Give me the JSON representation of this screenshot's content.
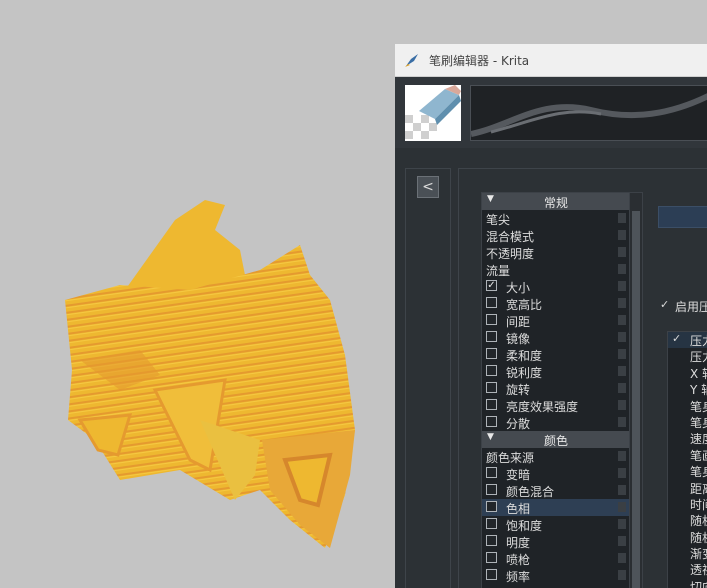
{
  "window": {
    "title": "笔刷编辑器 - Krita"
  },
  "colors": {
    "paint_primary": "#eeb830",
    "paint_secondary": "#e59a2f",
    "paint_dark": "#d6872c",
    "window_bg": "#31363b",
    "selected_row": "#2e3f54"
  },
  "icons": {
    "app": "krita-brush-icon",
    "collapse": "chevron-left-icon",
    "preset": "eraser-preset-icon"
  },
  "collapse_button": {
    "label": "<"
  },
  "options": {
    "categories": [
      {
        "label": "常规",
        "items": [
          {
            "label": "笔尖",
            "checkbox": false
          },
          {
            "label": "混合模式",
            "checkbox": false
          },
          {
            "label": "不透明度",
            "checkbox": false
          },
          {
            "label": "流量",
            "checkbox": false
          },
          {
            "label": "大小",
            "checkbox": true,
            "checked": true
          },
          {
            "label": "宽高比",
            "checkbox": true,
            "checked": false
          },
          {
            "label": "间距",
            "checkbox": true,
            "checked": false
          },
          {
            "label": "镜像",
            "checkbox": true,
            "checked": false
          },
          {
            "label": "柔和度",
            "checkbox": true,
            "checked": false
          },
          {
            "label": "锐利度",
            "checkbox": true,
            "checked": false
          },
          {
            "label": "旋转",
            "checkbox": true,
            "checked": false
          },
          {
            "label": "亮度效果强度",
            "checkbox": true,
            "checked": false
          },
          {
            "label": "分散",
            "checkbox": true,
            "checked": false
          }
        ]
      },
      {
        "label": "颜色",
        "items": [
          {
            "label": "颜色来源",
            "checkbox": false
          },
          {
            "label": "变暗",
            "checkbox": true,
            "checked": false
          },
          {
            "label": "颜色混合",
            "checkbox": true,
            "checked": false
          },
          {
            "label": "色相",
            "checkbox": true,
            "checked": false,
            "selected": true
          },
          {
            "label": "饱和度",
            "checkbox": true,
            "checked": false
          },
          {
            "label": "明度",
            "checkbox": true,
            "checked": false
          },
          {
            "label": "喷枪",
            "checkbox": true,
            "checked": false
          },
          {
            "label": "频率",
            "checkbox": true,
            "checked": false
          }
        ]
      }
    ]
  },
  "pressure": {
    "label": "启用压",
    "checked": true
  },
  "sensors": [
    {
      "label": "压力",
      "checked": true
    },
    {
      "label": "压力",
      "checked": false
    },
    {
      "label": "X 轴",
      "checked": false
    },
    {
      "label": "Y 轴",
      "checked": false
    },
    {
      "label": "笔身",
      "checked": false
    },
    {
      "label": "笔身",
      "checked": false
    },
    {
      "label": "速度",
      "checked": false
    },
    {
      "label": "笔画",
      "checked": false
    },
    {
      "label": "笔身",
      "checked": false
    },
    {
      "label": "距离",
      "checked": false
    },
    {
      "label": "时间",
      "checked": false
    },
    {
      "label": "随机",
      "checked": false
    },
    {
      "label": "随机",
      "checked": false
    },
    {
      "label": "渐变",
      "checked": false
    },
    {
      "label": "透视",
      "checked": false
    },
    {
      "label": "切向",
      "checked": false
    }
  ]
}
